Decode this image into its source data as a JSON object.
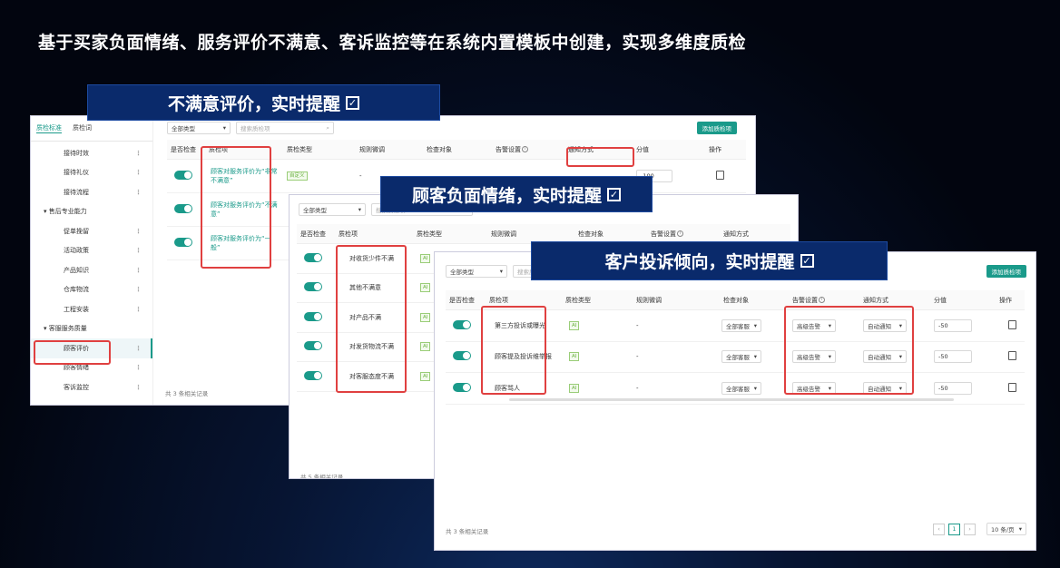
{
  "headline": "基于买家负面情绪、服务评价不满意、客诉监控等在系统内置模板中创建，实现多维度质检",
  "banners": {
    "b1": "不满意评价，实时提醒",
    "b2": "顾客负面情绪，实时提醒",
    "b3": "客户投诉倾向，实时提醒",
    "check_glyph": "✓"
  },
  "w1": {
    "tabs": [
      "质检标准",
      "质检词"
    ],
    "sidebar": [
      {
        "label": "接待时效",
        "group": false
      },
      {
        "label": "接待礼仪",
        "group": false
      },
      {
        "label": "接待流程",
        "group": false
      },
      {
        "label": "▾ 售后专业能力",
        "group": true
      },
      {
        "label": "促单挽留",
        "group": false
      },
      {
        "label": "活动政策",
        "group": false
      },
      {
        "label": "产品知识",
        "group": false
      },
      {
        "label": "仓库物流",
        "group": false
      },
      {
        "label": "工程安装",
        "group": false
      },
      {
        "label": "▾ 客服服务质量",
        "group": true
      },
      {
        "label": "顾客评价",
        "group": false
      },
      {
        "label": "顾客情绪",
        "group": false
      },
      {
        "label": "客诉监控",
        "group": false
      }
    ],
    "type_select": "全部类型",
    "search_placeholder": "搜索质检项",
    "add_button": "添加质检项",
    "headers": [
      "是否检查",
      "质检项",
      "质检类型",
      "规则微调",
      "检查对象",
      "告警设置",
      "通知方式",
      "分值",
      "操作"
    ],
    "rows": [
      {
        "item": "顾客对服务评价为“非常不满意”",
        "tag": "自定义",
        "rule": "-",
        "score": "-100"
      },
      {
        "item": "顾客对服务评价为“不满意”",
        "tag": "",
        "rule": "",
        "score": ""
      },
      {
        "item": "顾客对服务评价为“一般”",
        "tag": "",
        "rule": "",
        "score": ""
      }
    ],
    "footer": "共 3 条相关记录"
  },
  "w2": {
    "type_select": "全部类型",
    "search_placeholder": "搜索质检项",
    "headers": [
      "是否检查",
      "质检项",
      "质检类型",
      "规则微调",
      "检查对象",
      "告警设置",
      "通知方式"
    ],
    "rows": [
      {
        "item": "对收货少件不满",
        "tag": "AI"
      },
      {
        "item": "其他不满意",
        "tag": "AI"
      },
      {
        "item": "对产品不满",
        "tag": "AI"
      },
      {
        "item": "对发货物流不满",
        "tag": "AI"
      },
      {
        "item": "对客服态度不满",
        "tag": "AI"
      }
    ],
    "footer": "共 5 条相关记录"
  },
  "w3": {
    "type_select": "全部类型",
    "search_placeholder": "搜索质检项",
    "add_button": "添加质检项",
    "headers": [
      "是否检查",
      "质检项",
      "质检类型",
      "规则微调",
      "检查对象",
      "告警设置",
      "通知方式",
      "分值",
      "操作"
    ],
    "rows": [
      {
        "item": "第三方投诉或曝光",
        "tag": "AI",
        "rule": "-",
        "target": "全部客服",
        "alarm": "高级告警",
        "notify": "自动通知",
        "score": "-50"
      },
      {
        "item": "顾客提及投诉维举报",
        "tag": "AI",
        "rule": "-",
        "target": "全部客服",
        "alarm": "高级告警",
        "notify": "自动通知",
        "score": "-50"
      },
      {
        "item": "顾客骂人",
        "tag": "AI",
        "rule": "-",
        "target": "全部客服",
        "alarm": "高级告警",
        "notify": "自动通知",
        "score": "-50"
      }
    ],
    "footer": "共 3 条相关记录",
    "page": "1",
    "page_size": "10 条/页"
  }
}
